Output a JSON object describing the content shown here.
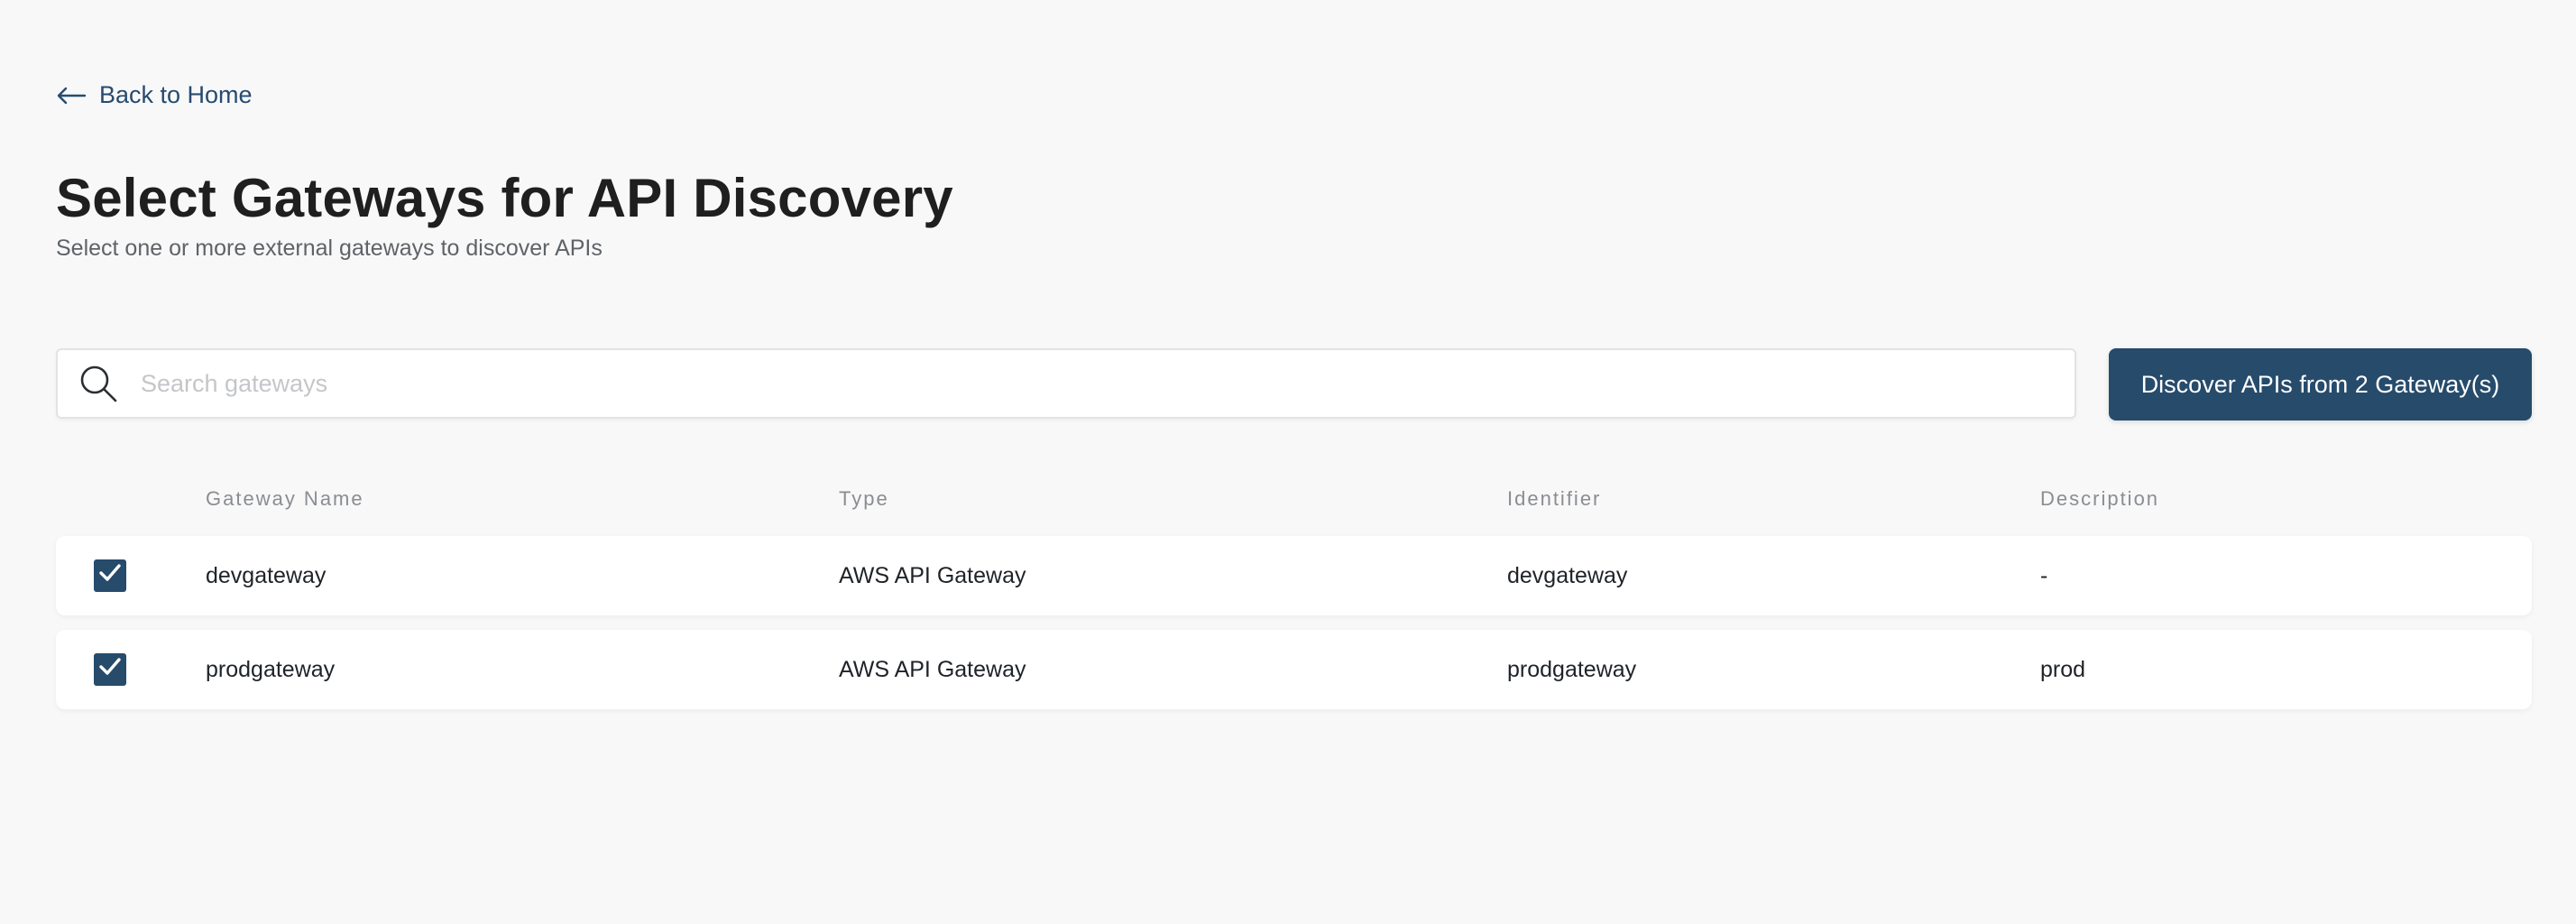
{
  "nav": {
    "back_label": "Back to Home"
  },
  "header": {
    "title": "Select Gateways for API Discovery",
    "subtitle": "Select one or more external gateways to discover APIs"
  },
  "search": {
    "placeholder": "Search gateways",
    "value": ""
  },
  "actions": {
    "discover_label": "Discover APIs from 2 Gateway(s)"
  },
  "table": {
    "columns": [
      "Gateway Name",
      "Type",
      "Identifier",
      "Description"
    ],
    "rows": [
      {
        "checked": true,
        "name": "devgateway",
        "type": "AWS API Gateway",
        "identifier": "devgateway",
        "description": "-"
      },
      {
        "checked": true,
        "name": "prodgateway",
        "type": "AWS API Gateway",
        "identifier": "prodgateway",
        "description": "prod"
      }
    ]
  },
  "colors": {
    "background": "#f8f8f8",
    "primary": "#264b6b",
    "link": "#264b70",
    "muted_text": "#8a8d91"
  },
  "icons": {
    "back": "arrow-left-icon",
    "search": "search-icon",
    "checkbox": "checkmark-icon"
  }
}
